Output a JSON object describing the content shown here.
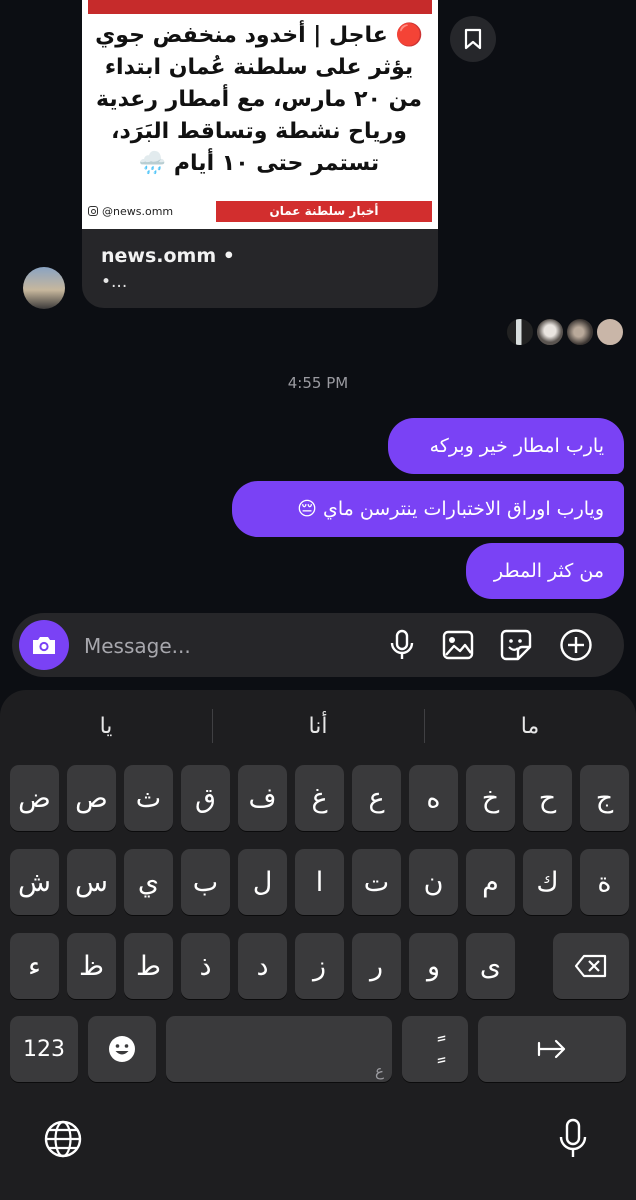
{
  "post": {
    "lines": [
      "🔴 عاجل | أخدود منخفض جوي",
      "يؤثر على سلطنة عُمان ابتداء",
      "من ٢٠ مارس، مع أمطار رعدية",
      "ورياح نشطة وتساقط البَرَد،",
      "تستمر حتى ١٠ أيام 🌧️"
    ],
    "handle": "@news.omm",
    "brand": "أخبار سلطنة عمان",
    "author": "news.omm •",
    "caption": "•..."
  },
  "timestamp": "4:55 PM",
  "messages": [
    "يارب امطار خير وبركه",
    "ويارب اوراق الاختبارات ينترسن ماي 😔",
    "من كثر المطر"
  ],
  "composer": {
    "placeholder": "Message..."
  },
  "keyboard": {
    "suggestions": [
      "يا",
      "أنا",
      "ما"
    ],
    "rows": [
      [
        "ض",
        "ص",
        "ث",
        "ق",
        "ف",
        "غ",
        "ع",
        "ه",
        "خ",
        "ح",
        "ج"
      ],
      [
        "ش",
        "س",
        "ي",
        "ب",
        "ل",
        "ا",
        "ت",
        "ن",
        "م",
        "ك",
        "ة"
      ],
      [
        "ء",
        "ظ",
        "ط",
        "ذ",
        "د",
        "ز",
        "ر",
        "و",
        "ى"
      ]
    ],
    "numbers_label": "123",
    "space_hint": "ع",
    "tanween_label": "ًٍ"
  },
  "colors": {
    "accent": "#7a42f5",
    "background": "#0c0e13",
    "bubble_incoming": "#262629",
    "key": "#3a3a3c"
  }
}
